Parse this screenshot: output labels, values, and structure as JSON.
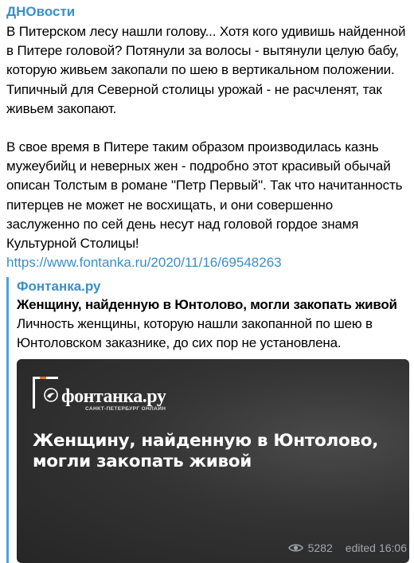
{
  "message": {
    "channel": "ДНОвости",
    "paragraphs": [
      "В Питерском лесу нашли голову... Хотя кого удивишь найденной в Питере головой? Потянули за волосы - вытянули целую бабу, которую живьем закопали по шею в вертикальном положении. Типичный для Северной столицы урожай - не расчленят, так живьем закопают.",
      "В свое время в Питере таким образом производилась казнь мужеубийц и неверных жен - подробно этот красивый обычай описан Толстым в романе \"Петр Первый\". Так что начитанность питерцев не может не восхищать, и они совершенно заслуженно по сей день несут над головой гордое знамя Культурной Столицы!"
    ],
    "link": "https://www.fontanka.ru/2020/11/16/69548263"
  },
  "preview": {
    "site_name": "Фонтанка.ру",
    "title": "Женщину, найденную в Юнтолово, могли закопать живой",
    "description": "Личность женщины, которую нашли закопанной по шею в Юнтоловском заказнике, до сих пор не установлена.",
    "image": {
      "logo_text": "фонтанка.ру",
      "logo_subtext": "САНКТ-ПЕТЕРБУРГ ОНЛАЙН",
      "headline": "Женщину, найденную в Юнтолово, могли закопать живой",
      "logo_accent_color": "#e8741f"
    }
  },
  "meta": {
    "views_icon": "eye-icon",
    "views": "5282",
    "edited_label": "edited",
    "time": "16:06"
  },
  "colors": {
    "link": "#3a8fc7",
    "preview_bar": "#4da3de",
    "meta": "#a0a7ae"
  }
}
